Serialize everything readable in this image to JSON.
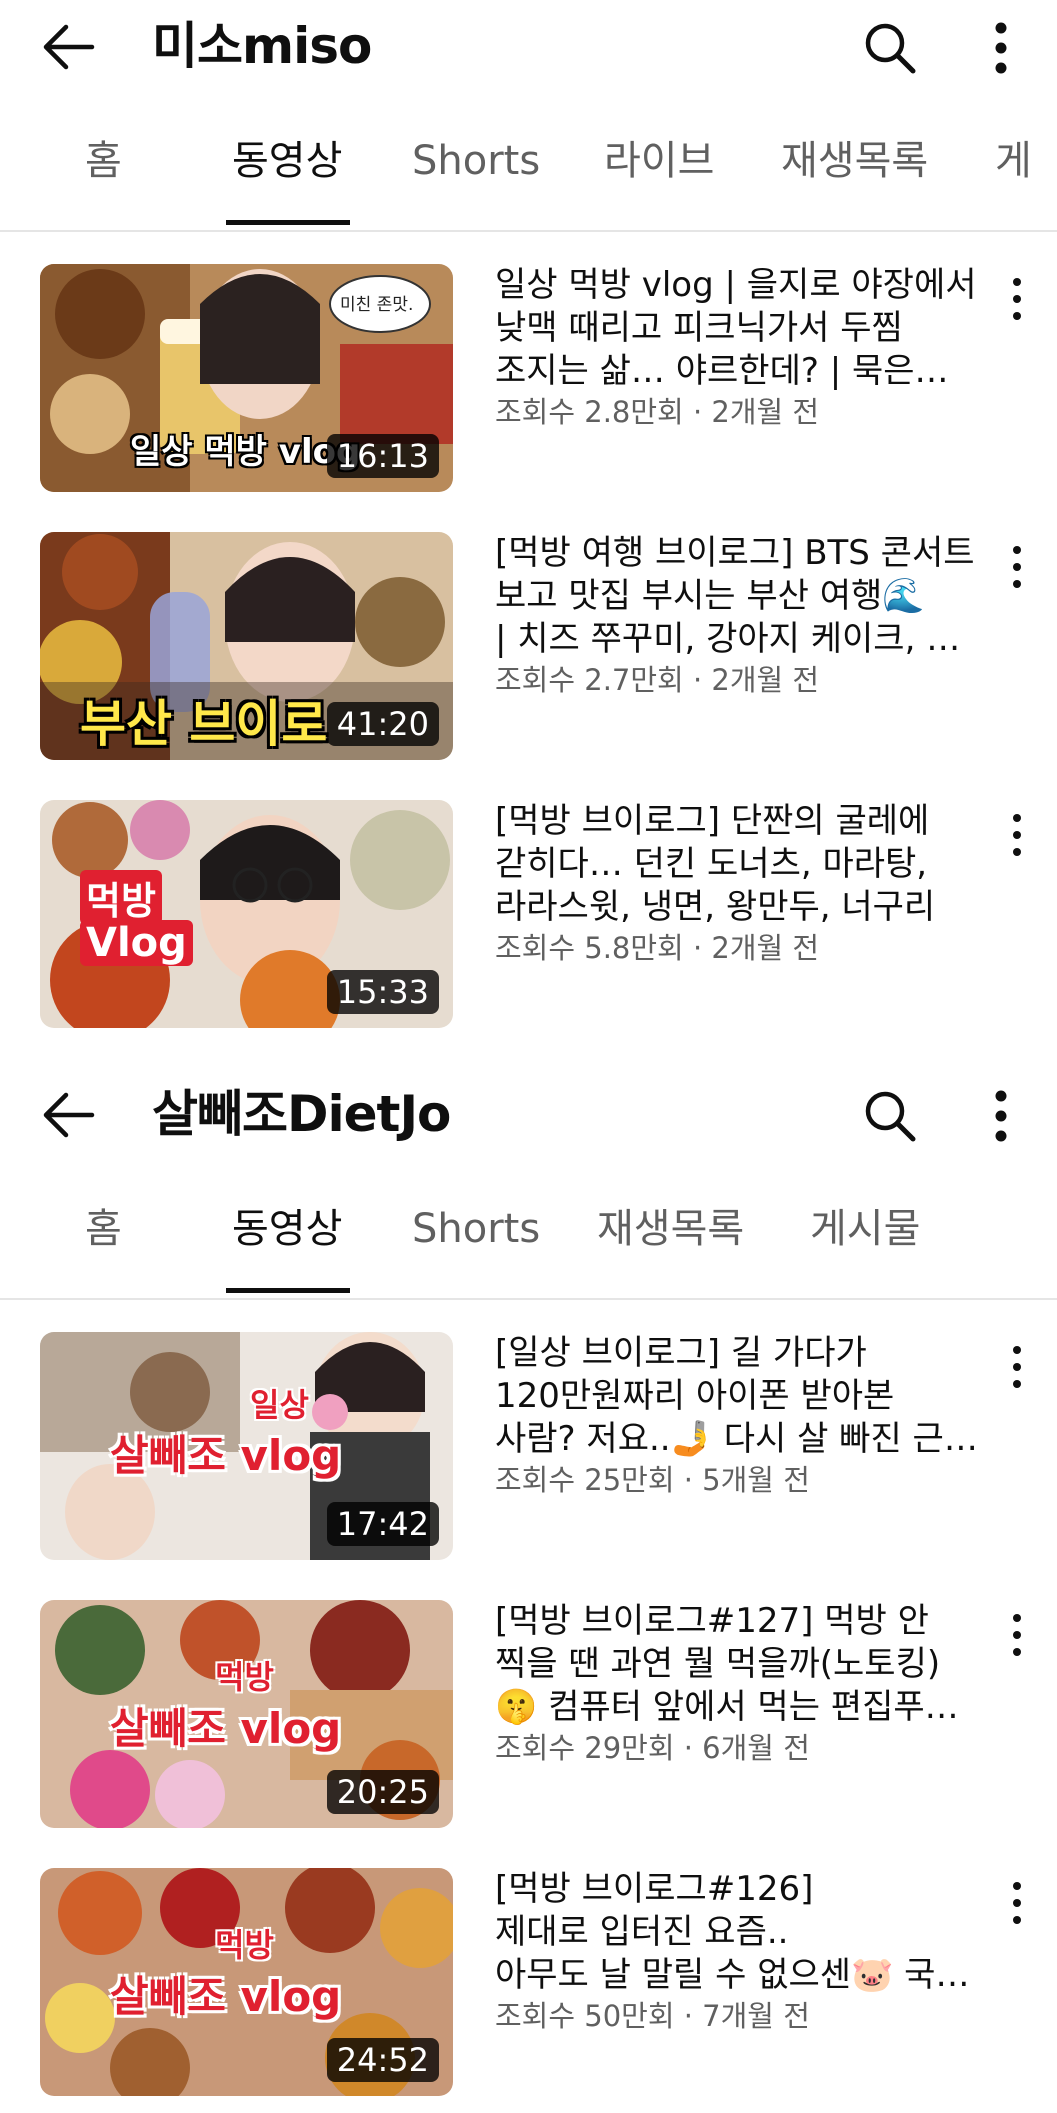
{
  "channels": [
    {
      "title": "미소miso",
      "tabs": [
        "홈",
        "동영상",
        "Shorts",
        "라이브",
        "재생목록",
        "게"
      ],
      "active_tab": "동영상",
      "videos": [
        {
          "title_lines": [
            "일상 먹방 vlog | 을지로 야장에서",
            "낮맥 때리고 피크닉가서 두찜",
            "조지는 삶… 야르한데? | 묵은…"
          ],
          "meta": "조회수 2.8만회 · 2개월 전",
          "duration": "16:13",
          "overlay": [
            "일상 먹방 vlog",
            "미친 존맛."
          ]
        },
        {
          "title_lines": [
            "[먹방 여행 브이로그] BTS 콘서트",
            "보고 맛집 부시는 부산 여행🌊",
            "| 치즈 쭈꾸미, 강아지 케이크, …"
          ],
          "meta": "조회수 2.7만회 · 2개월 전",
          "duration": "41:20",
          "overlay": [
            "부산 브이로"
          ]
        },
        {
          "title_lines": [
            "[먹방 브이로그] 단짠의 굴레에",
            "갇히다… 던킨 도너츠, 마라탕,",
            "라라스윗, 냉면, 왕만두, 너구리"
          ],
          "meta": "조회수 5.8만회 · 2개월 전",
          "duration": "15:33",
          "overlay": [
            "먹방",
            "Vlog"
          ]
        }
      ]
    },
    {
      "title": "살빼조DietJo",
      "tabs": [
        "홈",
        "동영상",
        "Shorts",
        "재생목록",
        "게시물"
      ],
      "active_tab": "동영상",
      "videos": [
        {
          "title_lines": [
            "[일상 브이로그] 길 가다가",
            "120만원짜리 아이폰 받아본",
            "사람? 저요..🤳 다시 살 빠진 근…"
          ],
          "meta": "조회수 25만회 · 5개월 전",
          "duration": "17:42",
          "overlay": [
            "일상",
            "살빼조 vlog"
          ]
        },
        {
          "title_lines": [
            "[먹방 브이로그#127] 먹방 안",
            "찍을 땐 과연 뭘 먹을까(노토킹)",
            "🤫 컴퓨터 앞에서 먹는 편집푸…"
          ],
          "meta": "조회수 29만회 · 6개월 전",
          "duration": "20:25",
          "overlay": [
            "먹방",
            "살빼조 vlog"
          ]
        },
        {
          "title_lines": [
            "[먹방 브이로그#126]",
            "제대로 입터진 요즘..",
            "아무도 날 말릴 수 없으센🐷 국…"
          ],
          "meta": "조회수 50만회 · 7개월 전",
          "duration": "24:52",
          "overlay": [
            "먹방",
            "살빼조 vlog"
          ]
        }
      ]
    }
  ],
  "icons": {
    "back": "arrow-left-icon",
    "search": "search-icon",
    "more": "more-vertical-icon"
  },
  "colors": {
    "text_primary": "#0f0f0f",
    "text_secondary": "#606060",
    "divider": "#e5e5e5",
    "duration_bg": "#000000"
  }
}
